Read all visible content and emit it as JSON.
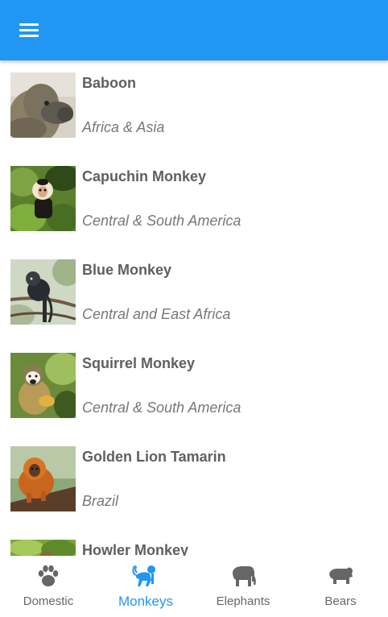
{
  "header": {
    "menu_icon": "hamburger-menu-icon",
    "color": "#2196f3"
  },
  "animals": [
    {
      "name": "Baboon",
      "location": "Africa & Asia"
    },
    {
      "name": "Capuchin Monkey",
      "location": "Central & South America"
    },
    {
      "name": "Blue Monkey",
      "location": "Central and East Africa"
    },
    {
      "name": "Squirrel Monkey",
      "location": "Central & South America"
    },
    {
      "name": "Golden Lion Tamarin",
      "location": "Brazil"
    },
    {
      "name": "Howler Monkey",
      "location": ""
    }
  ],
  "tabs": [
    {
      "label": "Domestic",
      "icon": "paw-icon",
      "active": false
    },
    {
      "label": "Monkeys",
      "icon": "monkey-icon",
      "active": true
    },
    {
      "label": "Elephants",
      "icon": "elephant-icon",
      "active": false
    },
    {
      "label": "Bears",
      "icon": "bear-icon",
      "active": false
    }
  ],
  "colors": {
    "accent": "#2196f3",
    "inactive_tab": "#666666",
    "name_text": "#5f5f5f",
    "location_text": "#777777"
  }
}
